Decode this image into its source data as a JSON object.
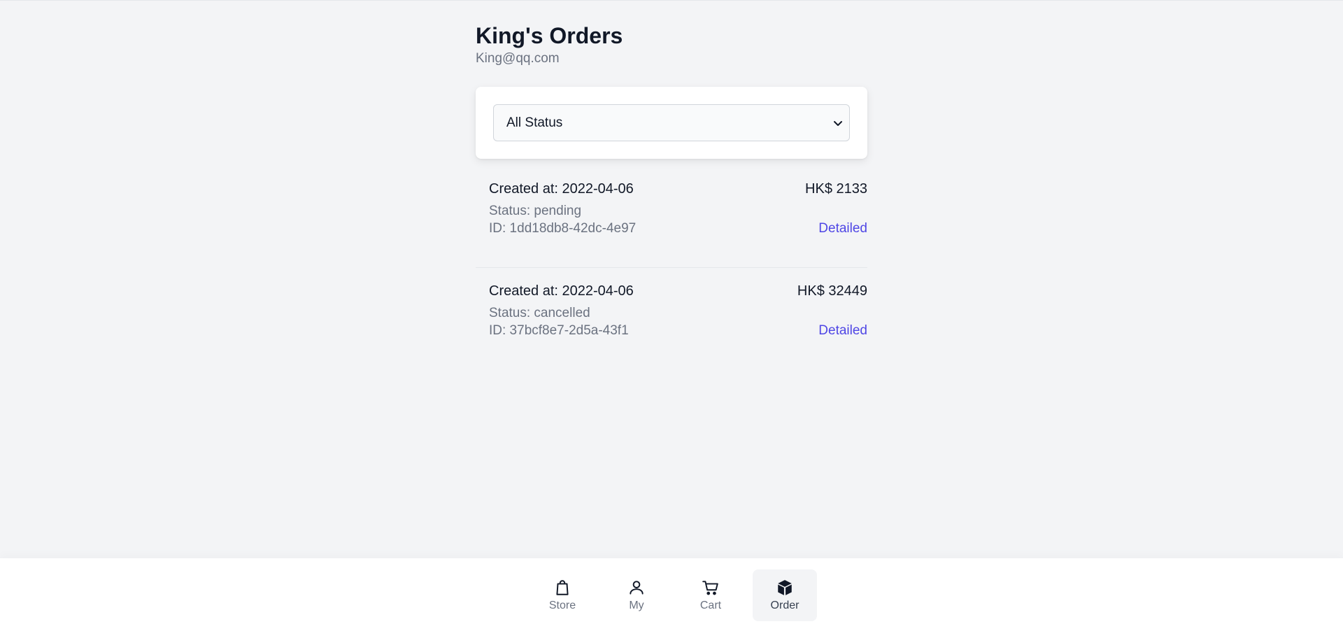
{
  "header": {
    "name": "King's",
    "title_suffix": "Orders",
    "email": "King@qq.com"
  },
  "filter": {
    "selected": "All Status"
  },
  "orders": [
    {
      "created": "Created at: 2022-04-06",
      "amount": "HK$ 2133",
      "status": "Status: pending",
      "id": "ID: 1dd18db8-42dc-4e97",
      "link": "Detailed"
    },
    {
      "created": "Created at: 2022-04-06",
      "amount": "HK$ 32449",
      "status": "Status: cancelled",
      "id": "ID: 37bcf8e7-2d5a-43f1",
      "link": "Detailed"
    }
  ],
  "nav": {
    "items": [
      {
        "label": "Store",
        "icon": "shopping-bag-icon"
      },
      {
        "label": "My",
        "icon": "user-icon"
      },
      {
        "label": "Cart",
        "icon": "cart-icon"
      },
      {
        "label": "Order",
        "icon": "cube-icon"
      }
    ],
    "active": "Order"
  },
  "colors": {
    "background": "#f3f4f6",
    "accent_link": "#4f46e5",
    "text_primary": "#111827",
    "text_secondary": "#6b7280"
  }
}
